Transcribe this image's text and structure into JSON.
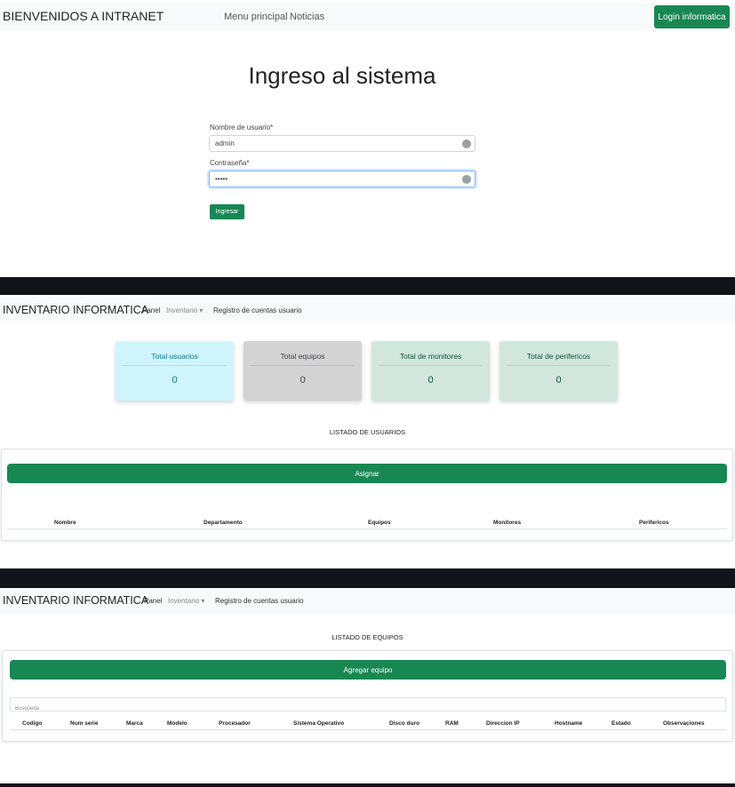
{
  "login_screen": {
    "brand": "BIENVENIDOS A INTRANET",
    "nav_links": [
      "Menu principal",
      "Noticias"
    ],
    "login_button": "Login informatica",
    "title": "Ingreso al sistema",
    "username_label": "Nombre de usuario*",
    "username_value": "admin",
    "password_label": "Contraseña*",
    "password_value": "•••••",
    "submit_label": "Ingresar"
  },
  "inventory_nav": {
    "brand": "INVENTARIO INFORMATICA",
    "panel": "Panel",
    "inventario": "Inventario",
    "dropdown_caret": "▾",
    "registro": "Registro de cuentas usuario"
  },
  "users_screen": {
    "cards": [
      {
        "label": "Total usuarios",
        "value": "0",
        "bg": "#cff4fc",
        "fg": "#087990"
      },
      {
        "label": "Total equipos",
        "value": "0",
        "bg": "#d3d3d4",
        "fg": "#41464b"
      },
      {
        "label": "Total de monitores",
        "value": "0",
        "bg": "#d1e7dd",
        "fg": "#0f5132"
      },
      {
        "label": "Total de perifericos",
        "value": "0",
        "bg": "#d1e7dd",
        "fg": "#0f5132"
      }
    ],
    "list_title": "LISTADO DE USUARIOS",
    "assign_button": "Asignar",
    "columns": [
      "Nombre",
      "Departamento",
      "Equipos",
      "Monitores",
      "Perifericos"
    ]
  },
  "equipment_screen": {
    "list_title": "LISTADO DE EQUIPOS",
    "add_button": "Agregar equipo",
    "search_placeholder": "Busqueda",
    "columns": [
      "Codigo",
      "Num serie",
      "Marca",
      "Modelo",
      "Procesador",
      "Sistema Operativo",
      "Disco duro",
      "RAM",
      "Direccion IP",
      "Hostname",
      "Estado",
      "Observaciones"
    ]
  },
  "colors": {
    "primary_green": "#198754",
    "separator": "#111318"
  }
}
